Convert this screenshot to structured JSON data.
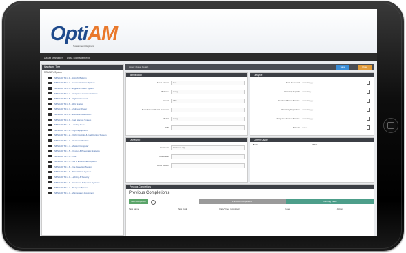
{
  "app": {
    "logo_opti": "Opti",
    "logo_am": "AM",
    "logo_tag": "Sustainment Regimens"
  },
  "nav": {
    "items": [
      "Asset Manager",
      "Data Management"
    ]
  },
  "sidebar": {
    "header": "Hardware Tree",
    "root": "PRIMARY System",
    "items": [
      "SBS 4.00 TR-0.1 - Aircraft Platform",
      "SBS 4.00 TR-0.2 - Communications System",
      "SBS 4.00 TR-0.3 - Engine & Power System",
      "SBS 4.00 TR-0.4 - Navigation Communications",
      "SBS 4.00 TR-0.5 - Flight Instruments",
      "SBS 4.00 TR-0.6 - APU System",
      "SBS 4.00 TR-0.7 - Hydraulic Power",
      "SBS 4.00 TR-0.8 - Electrical Distribution",
      "SBS 4.00 TR-0.9 - Fuel Storage System",
      "SBS 4.00 TR-1.0 - Landing Gear",
      "SBS 4.00 TR-1.1 - Flight Equipment",
      "SBS 4.00 TR-1.2 - Flight Controls & Fuel Control System",
      "SBS 4.00 TR-1.3 - Electronic Warfare",
      "SBS 4.00 TR-1.4 - Mission Computer",
      "SBS 4.00 TR-1.5 - Oxygen & Pneumatic Systems",
      "SBS 4.00 TR-1.6 - Pitot",
      "SBS 4.00 TR-1.7 - Life & Environment System",
      "SBS 4.00 TR-1.8 - Fire Detection System",
      "SBS 4.00 TR-1.9 - Water/Waste System",
      "SBS 4.00 TR-2.0 - Lighting & Security",
      "SBS 4.00 TR-2.1 - Armament & Ejection Systems",
      "SBS 4.00 TR-2.2 - Weapons System",
      "SBS 4.00 TR-2.3 - Maintenance Equipment"
    ]
  },
  "main": {
    "breadcrumb": "Asset > Asset Details",
    "save_label": "Save",
    "close_label": "Close",
    "identification": {
      "title": "Identification",
      "fields": [
        {
          "label": "Asset name*",
          "value": "Sort"
        },
        {
          "label": "Platform",
          "value": "1 Org"
        },
        {
          "label": "Asset*",
          "value": "SBS"
        },
        {
          "label": "Manufacturer Serial Number*",
          "value": ""
        },
        {
          "label": "Model",
          "value": "1 Org"
        },
        {
          "label": "P/U",
          "value": ""
        }
      ]
    },
    "lifecycle": {
      "title": "Lifecycle",
      "fields": [
        {
          "label": "Date Received",
          "value": "mm/dd/yyyy"
        },
        {
          "label": "Warranty Expiry*",
          "value": "mm/dd/yy"
        },
        {
          "label": "Replaced From Service",
          "value": "mm/dd/yyyy"
        },
        {
          "label": "Warranty Expiration",
          "value": "mm/dd/yyyy"
        },
        {
          "label": "Projected End of Service",
          "value": "mm/dd/yyyy"
        },
        {
          "label": "Status*",
          "value": "Active"
        }
      ]
    },
    "ownership": {
      "title": "Ownership",
      "fields": [
        {
          "label": "Location*",
          "value": "Platforms HQ"
        },
        {
          "label": "Custodian",
          "value": ""
        },
        {
          "label": "Other Group",
          "value": ""
        }
      ]
    },
    "usage": {
      "title": "Current Usage",
      "columns": [
        "Name",
        "Value"
      ]
    },
    "previous": {
      "header": "Previous Completions",
      "title": "Previous Completions",
      "add_label": "Add Completion",
      "tab1": "Previous Completions",
      "tab2": "Planning Tasks",
      "columns": [
        "Task name",
        "Task Code",
        "Date/Time Completed",
        "User",
        "Action"
      ]
    }
  }
}
